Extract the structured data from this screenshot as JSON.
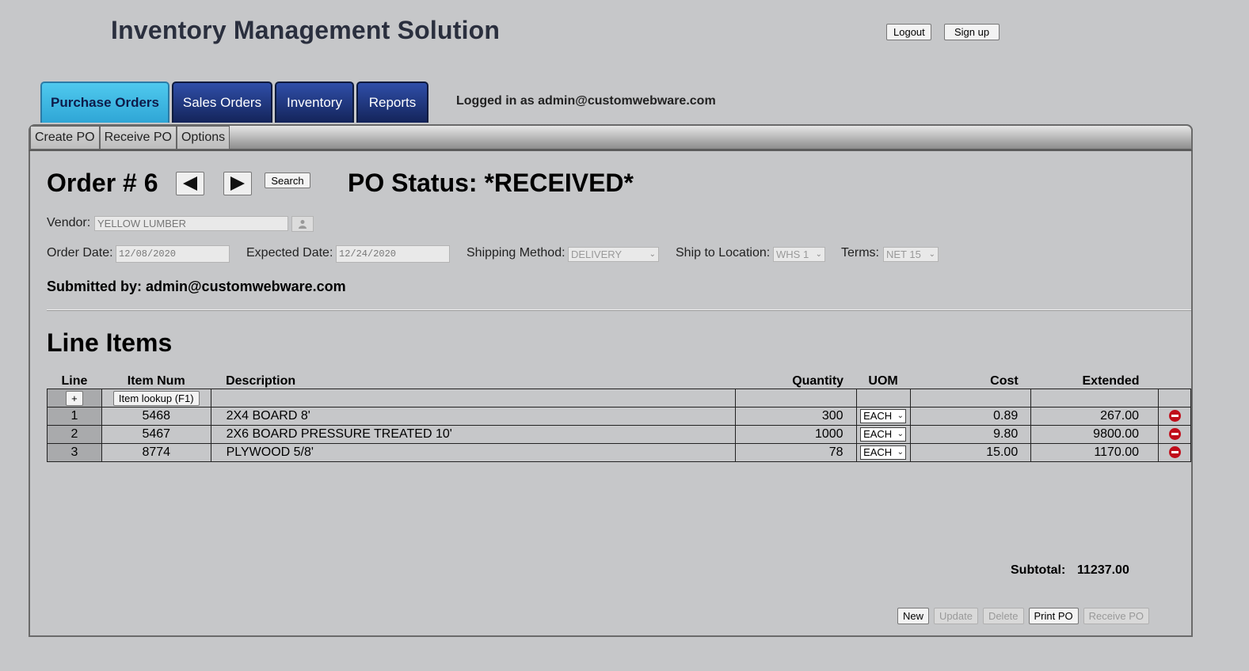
{
  "header": {
    "app_title": "Inventory Management Solution",
    "logout_label": "Logout",
    "signup_label": "Sign up",
    "logged_in_text": "Logged in as admin@customwebware.com"
  },
  "main_tabs": [
    {
      "label": "Purchase Orders",
      "active": true
    },
    {
      "label": "Sales Orders",
      "active": false
    },
    {
      "label": "Inventory",
      "active": false
    },
    {
      "label": "Reports",
      "active": false
    }
  ],
  "sub_tabs": [
    {
      "label": "Create PO"
    },
    {
      "label": "Receive PO"
    },
    {
      "label": "Options"
    }
  ],
  "order": {
    "title": "Order # 6",
    "search_label": "Search",
    "po_status": "PO Status: *RECEIVED*",
    "vendor_label": "Vendor:",
    "vendor_value": "YELLOW LUMBER",
    "order_date_label": "Order Date:",
    "order_date_value": "12/08/2020",
    "expected_date_label": "Expected Date:",
    "expected_date_value": "12/24/2020",
    "shipping_method_label": "Shipping Method:",
    "shipping_method_value": "DELIVERY",
    "ship_to_label": "Ship to Location:",
    "ship_to_value": "WHS 1",
    "terms_label": "Terms:",
    "terms_value": "NET 15",
    "submitted_by": "Submitted by: admin@customwebware.com"
  },
  "line_items": {
    "title": "Line Items",
    "columns": {
      "line": "Line",
      "item_num": "Item Num",
      "description": "Description",
      "quantity": "Quantity",
      "uom": "UOM",
      "cost": "Cost",
      "extended": "Extended"
    },
    "add_label": "+",
    "lookup_label": "Item lookup (F1)",
    "rows": [
      {
        "line": "1",
        "item_num": "5468",
        "description": "2X4 BOARD 8'",
        "quantity": "300",
        "uom": "EACH",
        "cost": "0.89",
        "extended": "267.00"
      },
      {
        "line": "2",
        "item_num": "5467",
        "description": "2X6 BOARD PRESSURE TREATED 10'",
        "quantity": "1000",
        "uom": "EACH",
        "cost": "9.80",
        "extended": "9800.00"
      },
      {
        "line": "3",
        "item_num": "8774",
        "description": "PLYWOOD 5/8'",
        "quantity": "78",
        "uom": "EACH",
        "cost": "15.00",
        "extended": "1170.00"
      }
    ]
  },
  "totals": {
    "subtotal_label": "Subtotal:",
    "subtotal_value": "11237.00"
  },
  "actions": {
    "new_label": "New",
    "update_label": "Update",
    "delete_label": "Delete",
    "print_label": "Print PO",
    "receive_label": "Receive PO"
  },
  "icons": {
    "prev": "prev-arrow-icon",
    "next": "next-arrow-icon",
    "vendor_lookup": "user-lookup-icon",
    "delete_row": "remove-circle-icon"
  },
  "colors": {
    "active_tab": "#3fb8e4",
    "inactive_tab": "#233a87",
    "delete_icon": "#c00d1a",
    "background": "#c6c7c9"
  }
}
